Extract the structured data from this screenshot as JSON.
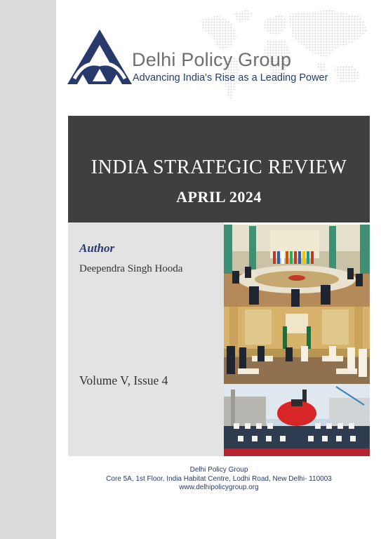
{
  "organization": {
    "name": "Delhi Policy Group",
    "tagline": "Advancing India's Rise as a Leading Power"
  },
  "report": {
    "title": "INDIA STRATEGIC REVIEW",
    "date": "APRIL 2024",
    "author_label": "Author",
    "author_name": "Deependra Singh Hooda",
    "volume": "Volume V, Issue 4"
  },
  "footer": {
    "org": "Delhi Policy Group",
    "address": "Core 5A, 1st Floor, India Habitat Centre, Lodhi Road, New Delhi- 110003",
    "website": "www.delhipolicygroup.org"
  },
  "colors": {
    "navy": "#283a6b",
    "title_band": "#3f3f3f",
    "side_strip": "#dcdcdc",
    "info_panel": "#e3e3e3"
  }
}
